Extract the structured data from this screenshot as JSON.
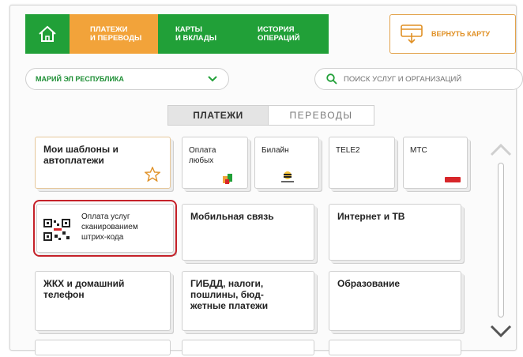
{
  "nav": {
    "home_icon": "home-icon",
    "items": [
      {
        "label_line1": "ПЛАТЕЖИ",
        "label_line2": "И ПЕРЕВОДЫ",
        "active": true
      },
      {
        "label_line1": "КАРТЫ",
        "label_line2": "И ВКЛАДЫ",
        "active": false
      },
      {
        "label_line1": "ИСТОРИЯ",
        "label_line2": "ОПЕРАЦИЙ",
        "active": false
      }
    ],
    "return_card": {
      "label": "ВЕРНУТЬ КАРТУ",
      "icon": "card-return-icon"
    }
  },
  "region": {
    "value": "МАРИЙ ЭЛ РЕСПУБЛИКА",
    "icon": "chevron-down-icon"
  },
  "search": {
    "placeholder": "ПОИСК УСЛУГ И ОРГАНИЗАЦИЙ",
    "icon": "search-icon"
  },
  "tabs": [
    {
      "label": "ПЛАТЕЖИ",
      "active": true
    },
    {
      "label": "ПЕРЕВОДЫ",
      "active": false
    }
  ],
  "tiles": {
    "templates": {
      "line1": "Мои шаблоны и",
      "line2": "автоплатежи",
      "icon": "star-icon"
    },
    "any_payment": {
      "line1": "Оплата",
      "line2": "любых"
    },
    "beeline": {
      "label": "Билайн"
    },
    "tele2": {
      "label": "TELE2"
    },
    "mts": {
      "label": "МТС"
    },
    "barcode": {
      "line1": "Оплата услуг",
      "line2": "сканированием",
      "line3": "штрих-кода",
      "icon": "qr-code-icon"
    },
    "mobile": {
      "label": "Мобильная связь"
    },
    "internet": {
      "label": "Интернет и ТВ"
    },
    "utilities": {
      "line1": "ЖКХ и домашний",
      "line2": "телефон"
    },
    "gibdd": {
      "line1": "ГИБДД, налоги,",
      "line2": "пошлины, бюд-",
      "line3": "жетные платежи"
    },
    "education": {
      "label": "Образование"
    }
  },
  "scroll": {
    "up_icon": "chevron-up-icon",
    "down_icon": "chevron-down-icon"
  },
  "colors": {
    "green": "#21a038",
    "orange": "#f2a33a",
    "accent_text": "#e09025",
    "selection": "#c52129"
  }
}
